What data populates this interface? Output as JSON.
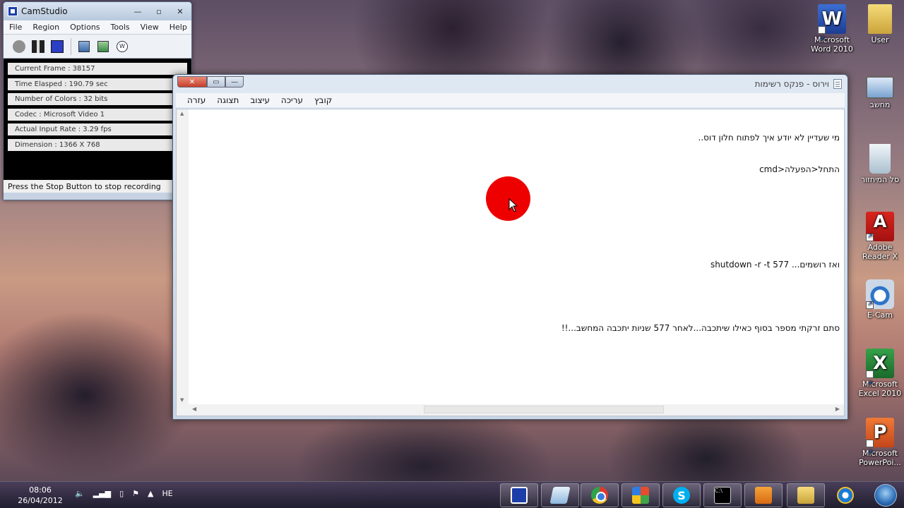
{
  "camstudio": {
    "title": "CamStudio",
    "menu": [
      "File",
      "Region",
      "Options",
      "Tools",
      "View",
      "Help"
    ],
    "info": [
      "Current Frame : 38157",
      "Time Elasped : 190.79 sec",
      "Number of Colors : 32 bits",
      "Codec : Microsoft Video 1",
      "Actual Input Rate : 3.29 fps",
      "Dimension : 1366 X 768"
    ],
    "status": "Press the Stop Button to stop recording"
  },
  "notepad": {
    "title": "וירוס - פנקס רשימות",
    "menu": [
      "קובץ",
      "עריכה",
      "עיצוב",
      "תצוגה",
      "עזרה"
    ],
    "lines": [
      "מי שעדיין לא יודע איך לפתוח חלון דוס..",
      "התחל<הפעלה<cmd",
      "",
      "",
      "ואז רושמים... shutdown -r -t 577",
      "",
      "סתם זרקתי מספר בסוף כאילו שיתכבה...לאחר 577 שניות יתכבה המחשב...!!"
    ]
  },
  "desktop_icons": [
    {
      "label": "Microsoft Word 2010",
      "icon": "word-icon"
    },
    {
      "label": "User",
      "icon": "folder-icon"
    },
    {
      "label": "מחשב",
      "icon": "computer-icon"
    },
    {
      "label": "סל המיחזור",
      "icon": "recycle-bin-icon"
    },
    {
      "label": "Adobe Reader X",
      "icon": "adobe-reader-icon"
    },
    {
      "label": "E-Cam",
      "icon": "ecam-icon"
    },
    {
      "label": "Microsoft Excel 2010",
      "icon": "excel-icon"
    },
    {
      "label": "Microsoft PowerPoi...",
      "icon": "powerpoint-icon"
    }
  ],
  "taskbar": {
    "time": "08:06",
    "date": "26/04/2012",
    "language": "HE"
  },
  "colors": {
    "cursor_highlight": "#ee0000",
    "taskbar": "#2e2a3f"
  }
}
